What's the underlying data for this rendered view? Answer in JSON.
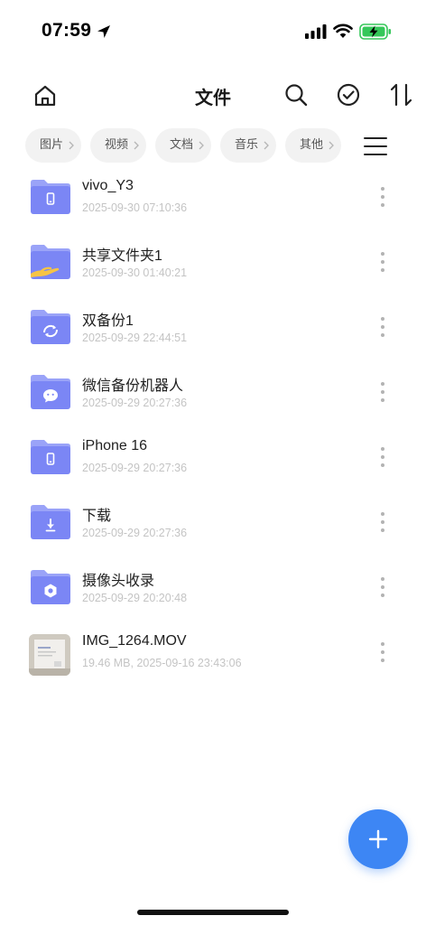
{
  "status_bar": {
    "time": "07:59"
  },
  "header": {
    "title": "文件"
  },
  "categories": [
    {
      "label": "图片"
    },
    {
      "label": "视频"
    },
    {
      "label": "文档"
    },
    {
      "label": "音乐"
    },
    {
      "label": "其他"
    }
  ],
  "files": [
    {
      "name": "vivo_Y3",
      "meta": "2025-09-30 07:10:36",
      "icon": "folder-phone-icon"
    },
    {
      "name": "共享文件夹1",
      "meta": "2025-09-30 01:40:21",
      "icon": "folder-share-icon"
    },
    {
      "name": "双备份1",
      "meta": "2025-09-29 22:44:51",
      "icon": "folder-backup-icon"
    },
    {
      "name": "微信备份机器人",
      "meta": "2025-09-29 20:27:36",
      "icon": "folder-wechat-icon"
    },
    {
      "name": "iPhone 16",
      "meta": "2025-09-29 20:27:36",
      "icon": "folder-phone-icon"
    },
    {
      "name": "下载",
      "meta": "2025-09-29 20:27:36",
      "icon": "folder-download-icon"
    },
    {
      "name": "摄像头收录",
      "meta": "2025-09-29 20:20:48",
      "icon": "folder-camera-icon"
    },
    {
      "name": "IMG_1264.MOV",
      "meta": "19.46 MB, 2025-09-16 23:43:06",
      "icon": "video-thumbnail"
    }
  ],
  "colors": {
    "folder": "#7b86f5",
    "folder_light": "#9aa3f8",
    "accent": "#3d86f4",
    "chip_bg": "#f2f2f2",
    "meta_text": "#c4c4c4"
  }
}
